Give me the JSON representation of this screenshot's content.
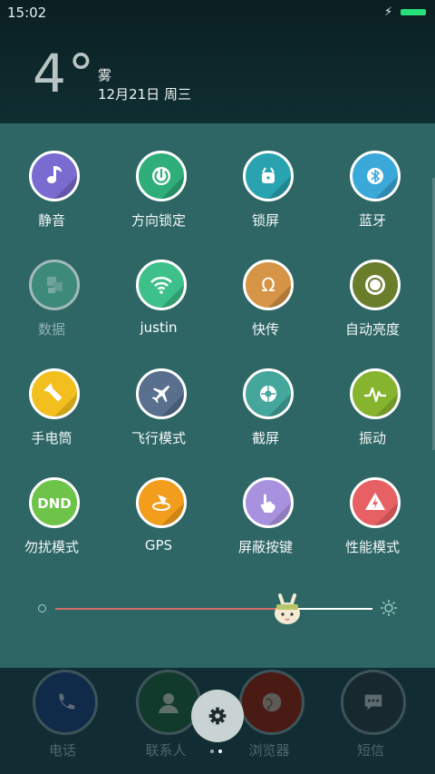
{
  "status_bar": {
    "time": "15:02"
  },
  "weather": {
    "temperature": "4°",
    "condition": "雾",
    "date": "12月21日 周三"
  },
  "quick_settings": [
    {
      "label": "静音",
      "icon": "music-note-icon",
      "color": "#7a6bd1",
      "active": true
    },
    {
      "label": "方向锁定",
      "icon": "power-lock-icon",
      "color": "#2fae7a",
      "active": true
    },
    {
      "label": "锁屏",
      "icon": "lock-icon",
      "color": "#2aa3b0",
      "active": true
    },
    {
      "label": "蓝牙",
      "icon": "bluetooth-icon",
      "color": "#3aa8d8",
      "active": true
    },
    {
      "label": "数据",
      "icon": "data-icon",
      "color": "#4aa88c",
      "active": false
    },
    {
      "label": "justin",
      "icon": "wifi-icon",
      "color": "#3ec08b",
      "active": true
    },
    {
      "label": "快传",
      "icon": "omega-icon",
      "color": "#d69546",
      "active": true
    },
    {
      "label": "自动亮度",
      "icon": "auto-brightness-icon",
      "color": "#6a7d2b",
      "active": true
    },
    {
      "label": "手电筒",
      "icon": "flashlight-icon",
      "color": "#f2bf1e",
      "active": true
    },
    {
      "label": "飞行模式",
      "icon": "airplane-icon",
      "color": "#58708e",
      "active": true
    },
    {
      "label": "截屏",
      "icon": "camera-aperture-icon",
      "color": "#45a69c",
      "active": true
    },
    {
      "label": "振动",
      "icon": "vibrate-icon",
      "color": "#86b42f",
      "active": true
    },
    {
      "label": "勿扰模式",
      "icon": "dnd-icon",
      "color": "#6ec349",
      "active": true
    },
    {
      "label": "GPS",
      "icon": "gps-icon",
      "color": "#f29d1b",
      "active": true
    },
    {
      "label": "屏蔽按键",
      "icon": "touch-block-icon",
      "color": "#a892e0",
      "active": true
    },
    {
      "label": "性能模式",
      "icon": "performance-icon",
      "color": "#e76063",
      "active": true
    }
  ],
  "brightness": {
    "level": 0.71
  },
  "dock": [
    {
      "label": "电话",
      "icon": "phone-icon",
      "color": "#102a4a"
    },
    {
      "label": "联系人",
      "icon": "contacts-icon",
      "color": "#123a2c"
    },
    {
      "label": "浏览器",
      "icon": "browser-icon",
      "color": "#4a1a14"
    },
    {
      "label": "短信",
      "icon": "messages-icon",
      "color": "#17282e"
    }
  ],
  "settings_button_icon": "gear-icon",
  "colors": {
    "panel_bg": "#2e6665",
    "brightness_track": "#d27066"
  }
}
